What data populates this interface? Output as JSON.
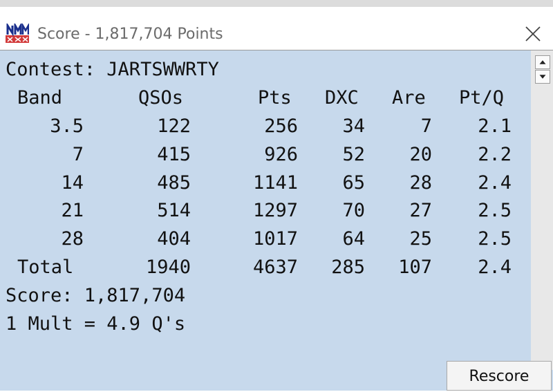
{
  "window": {
    "title": "Score - 1,817,704 Points",
    "app_icon": "n1mm-logo",
    "close_icon": "close-x"
  },
  "contest_line": "Contest: JARTSWWRTY",
  "table": {
    "headers": [
      "Band",
      "QSOs",
      "Pts",
      "DXC",
      "Are",
      "Pt/Q"
    ],
    "rows": [
      [
        "3.5",
        "122",
        "256",
        "34",
        "7",
        "2.1"
      ],
      [
        "7",
        "415",
        "926",
        "52",
        "20",
        "2.2"
      ],
      [
        "14",
        "485",
        "1141",
        "65",
        "28",
        "2.4"
      ],
      [
        "21",
        "514",
        "1297",
        "70",
        "27",
        "2.5"
      ],
      [
        "28",
        "404",
        "1017",
        "64",
        "25",
        "2.5"
      ],
      [
        "Total",
        "1940",
        "4637",
        "285",
        "107",
        "2.4"
      ]
    ]
  },
  "score_line": "Score: 1,817,704",
  "mult_line": "1 Mult = 4.9 Q's",
  "buttons": {
    "rescore": "Rescore"
  },
  "colors": {
    "background": "#c7d9ec",
    "text": "#111111"
  }
}
